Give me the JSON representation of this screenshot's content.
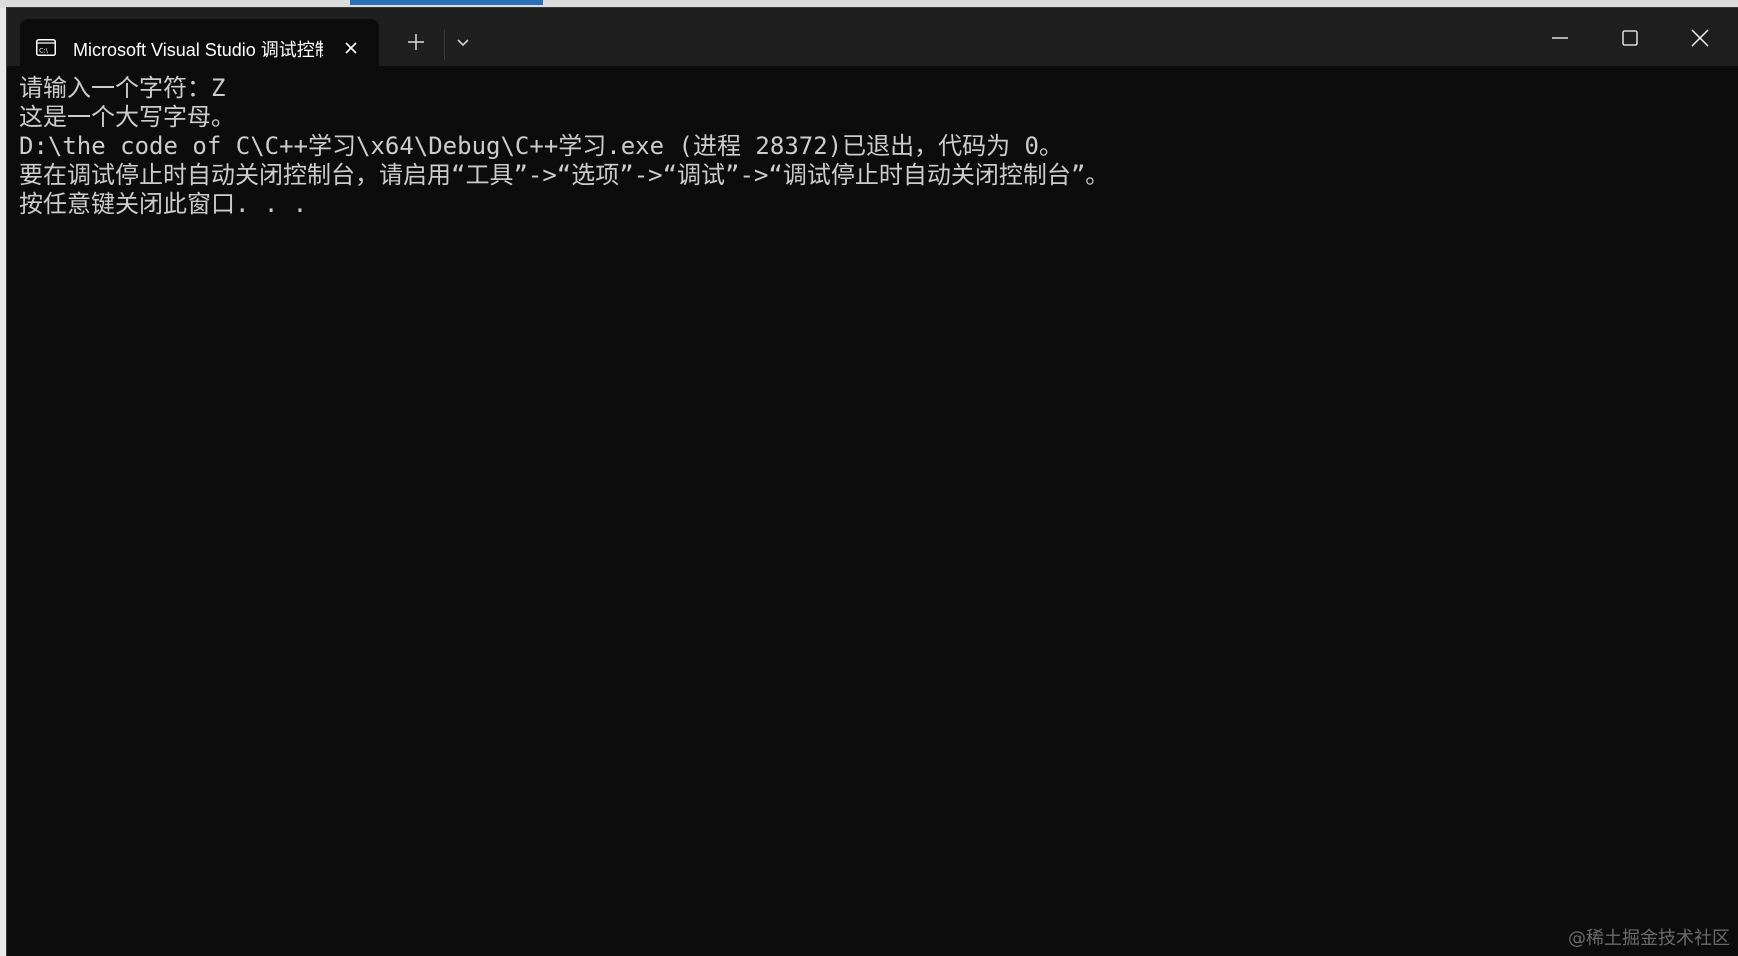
{
  "tab": {
    "title": "Microsoft Visual Studio 调试控制台",
    "icon": "console-app-icon"
  },
  "titlebar": {
    "new_tab_icon": "plus-icon",
    "dropdown_icon": "chevron-down-icon",
    "minimize_icon": "minimize-icon",
    "maximize_icon": "maximize-icon",
    "close_icon": "close-icon"
  },
  "console": {
    "lines": [
      "请输入一个字符：Z",
      "这是一个大写字母。",
      "D:\\the code of C\\C++学习\\x64\\Debug\\C++学习.exe (进程 28372)已退出，代码为 0。",
      "要在调试停止时自动关闭控制台，请启用“工具”->“选项”->“调试”->“调试停止时自动关闭控制台”。",
      "按任意键关闭此窗口. . ."
    ]
  },
  "watermark": "@稀土掘金技术社区",
  "colors": {
    "console_bg": "#0c0c0c",
    "titlebar_bg": "#1f1f1f",
    "console_text": "#cccccc"
  }
}
